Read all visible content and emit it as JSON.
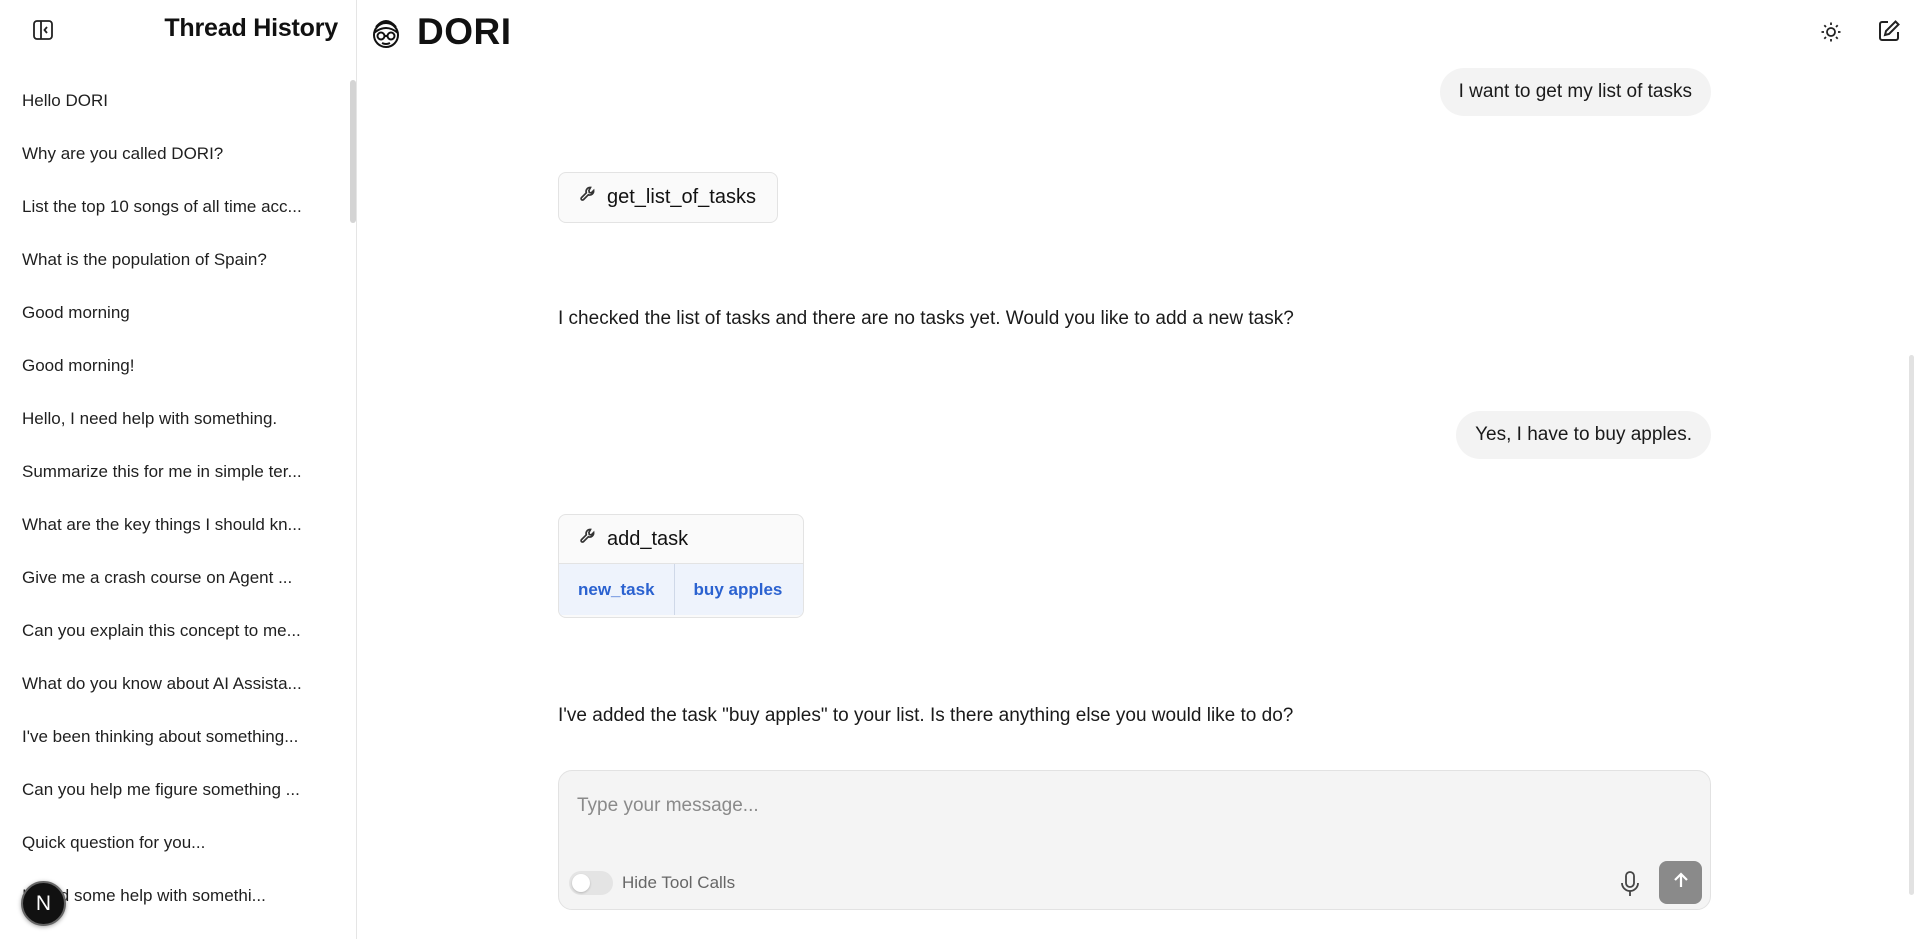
{
  "sidebar": {
    "title": "Thread History",
    "threads": [
      "Hello DORI",
      "Why are you called DORI?",
      "List the top 10 songs of all time acc...",
      "What is the population of Spain?",
      "Good morning",
      "Good morning!",
      "Hello, I need help with something.",
      "Summarize this for me in simple ter...",
      "What are the key things I should kn...",
      "Give me a crash course on Agent ...",
      "Can you explain this concept to me...",
      "What do you know about AI Assista...",
      "I've been thinking about something...",
      "Can you help me figure something ...",
      "Quick question for you...",
      "I need some help with somethi..."
    ],
    "avatar_initial": "N"
  },
  "header": {
    "brand": "DORI",
    "icons": {
      "collapse": "sidebar-collapse-icon",
      "theme": "sun-icon",
      "new_chat": "edit-icon"
    }
  },
  "messages": {
    "user_1": "I want to get my list of tasks",
    "tool_1": {
      "name": "get_list_of_tasks"
    },
    "assistant_1": "I checked the list of tasks and there are no tasks yet. Would you like to add a new task?",
    "user_2": "Yes, I have to buy apples.",
    "tool_2": {
      "name": "add_task",
      "arg_key": "new_task",
      "arg_value": "buy apples"
    },
    "assistant_2": "I've added the task \"buy apples\" to your list. Is there anything else you would like to do?"
  },
  "composer": {
    "placeholder": "Type your message...",
    "value": "",
    "toggle_label": "Hide Tool Calls",
    "toggle_on": false
  },
  "colors": {
    "accent_blue": "#2b62d0",
    "tool_args_bg": "#eef3fc",
    "bubble_bg": "#f3f3f3",
    "send_button": "#8a8a8a"
  }
}
